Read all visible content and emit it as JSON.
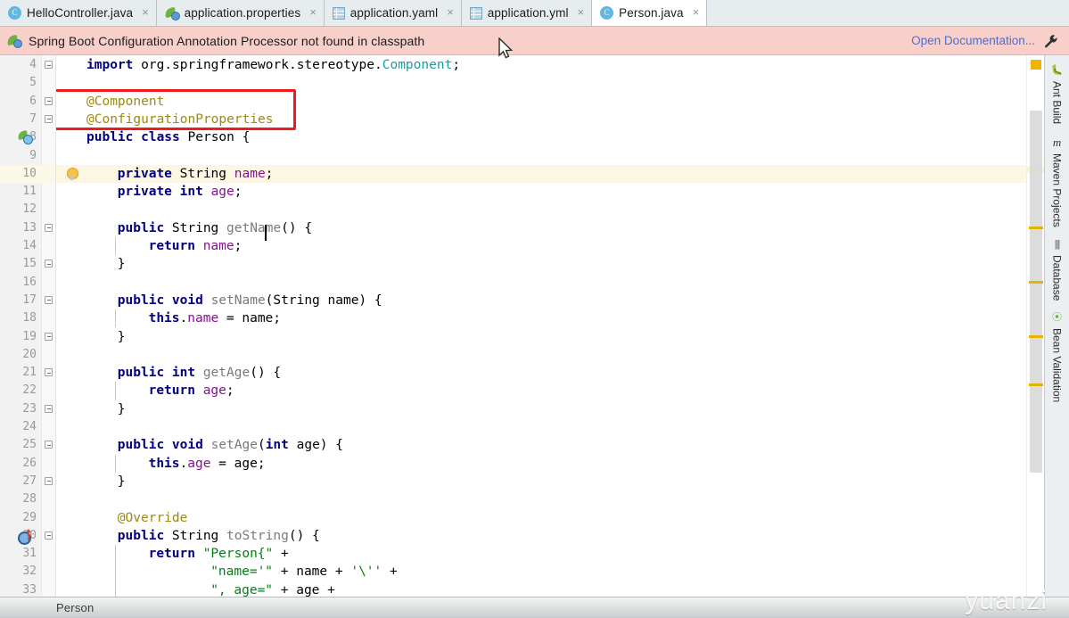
{
  "tabs": [
    {
      "label": "HelloController.java",
      "icon": "java-class-icon",
      "active": false,
      "close": "×"
    },
    {
      "label": "application.properties",
      "icon": "spring-properties-icon",
      "active": false,
      "close": "×"
    },
    {
      "label": "application.yaml",
      "icon": "yaml-file-icon",
      "active": false,
      "close": "×"
    },
    {
      "label": "application.yml",
      "icon": "yaml-file-icon",
      "active": false,
      "close": "×"
    },
    {
      "label": "Person.java",
      "icon": "java-class-icon",
      "active": true,
      "close": "×"
    }
  ],
  "banner": {
    "icon": "spring-boot-icon",
    "message": "Spring Boot Configuration Annotation Processor not found in classpath",
    "action_label": "Open Documentation...",
    "settings_icon": "wrench-icon",
    "background": "#f8cfc9",
    "link_color": "#4a6fd6"
  },
  "editor": {
    "caret_line": 10,
    "highlighted_line": 10,
    "lines": [
      {
        "n": "4",
        "indent": 0,
        "tokens": [
          {
            "t": "import ",
            "c": "kw"
          },
          {
            "t": "org.springframework.stereotype.",
            "c": "pln"
          },
          {
            "t": "Component",
            "c": "cls"
          },
          {
            "t": ";",
            "c": "pln"
          }
        ]
      },
      {
        "n": "5",
        "indent": 0,
        "tokens": []
      },
      {
        "n": "6",
        "indent": 0,
        "tokens": [
          {
            "t": "@Component",
            "c": "ann"
          }
        ]
      },
      {
        "n": "7",
        "indent": 0,
        "tokens": [
          {
            "t": "@ConfigurationProperties",
            "c": "ann"
          }
        ]
      },
      {
        "n": "8",
        "indent": 0,
        "tokens": [
          {
            "t": "public class ",
            "c": "kw"
          },
          {
            "t": "Person",
            "c": "pln"
          },
          {
            "t": " {",
            "c": "pln"
          }
        ]
      },
      {
        "n": "9",
        "indent": 0,
        "tokens": []
      },
      {
        "n": "10",
        "indent": 1,
        "tokens": [
          {
            "t": "private ",
            "c": "kw"
          },
          {
            "t": "String ",
            "c": "pln"
          },
          {
            "t": "name",
            "c": "fld"
          },
          {
            "t": ";",
            "c": "pln"
          }
        ]
      },
      {
        "n": "11",
        "indent": 1,
        "tokens": [
          {
            "t": "private int ",
            "c": "kw"
          },
          {
            "t": "age",
            "c": "fld"
          },
          {
            "t": ";",
            "c": "pln"
          }
        ]
      },
      {
        "n": "12",
        "indent": 0,
        "tokens": []
      },
      {
        "n": "13",
        "indent": 1,
        "tokens": [
          {
            "t": "public ",
            "c": "kw"
          },
          {
            "t": "String ",
            "c": "pln"
          },
          {
            "t": "getName",
            "c": "mth"
          },
          {
            "t": "() {",
            "c": "pln"
          }
        ]
      },
      {
        "n": "14",
        "indent": 2,
        "tokens": [
          {
            "t": "return ",
            "c": "kw"
          },
          {
            "t": "name",
            "c": "fld"
          },
          {
            "t": ";",
            "c": "pln"
          }
        ]
      },
      {
        "n": "15",
        "indent": 1,
        "tokens": [
          {
            "t": "}",
            "c": "pln"
          }
        ]
      },
      {
        "n": "16",
        "indent": 0,
        "tokens": []
      },
      {
        "n": "17",
        "indent": 1,
        "tokens": [
          {
            "t": "public void ",
            "c": "kw"
          },
          {
            "t": "setName",
            "c": "mth"
          },
          {
            "t": "(String name) {",
            "c": "pln"
          }
        ]
      },
      {
        "n": "18",
        "indent": 2,
        "tokens": [
          {
            "t": "this",
            "c": "kw"
          },
          {
            "t": ".",
            "c": "pln"
          },
          {
            "t": "name",
            "c": "fld"
          },
          {
            "t": " = name;",
            "c": "pln"
          }
        ]
      },
      {
        "n": "19",
        "indent": 1,
        "tokens": [
          {
            "t": "}",
            "c": "pln"
          }
        ]
      },
      {
        "n": "20",
        "indent": 0,
        "tokens": []
      },
      {
        "n": "21",
        "indent": 1,
        "tokens": [
          {
            "t": "public int ",
            "c": "kw"
          },
          {
            "t": "getAge",
            "c": "mth"
          },
          {
            "t": "() {",
            "c": "pln"
          }
        ]
      },
      {
        "n": "22",
        "indent": 2,
        "tokens": [
          {
            "t": "return ",
            "c": "kw"
          },
          {
            "t": "age",
            "c": "fld"
          },
          {
            "t": ";",
            "c": "pln"
          }
        ]
      },
      {
        "n": "23",
        "indent": 1,
        "tokens": [
          {
            "t": "}",
            "c": "pln"
          }
        ]
      },
      {
        "n": "24",
        "indent": 0,
        "tokens": []
      },
      {
        "n": "25",
        "indent": 1,
        "tokens": [
          {
            "t": "public void ",
            "c": "kw"
          },
          {
            "t": "setAge",
            "c": "mth"
          },
          {
            "t": "(",
            "c": "pln"
          },
          {
            "t": "int ",
            "c": "kw"
          },
          {
            "t": "age) {",
            "c": "pln"
          }
        ]
      },
      {
        "n": "26",
        "indent": 2,
        "tokens": [
          {
            "t": "this",
            "c": "kw"
          },
          {
            "t": ".",
            "c": "pln"
          },
          {
            "t": "age",
            "c": "fld"
          },
          {
            "t": " = age;",
            "c": "pln"
          }
        ]
      },
      {
        "n": "27",
        "indent": 1,
        "tokens": [
          {
            "t": "}",
            "c": "pln"
          }
        ]
      },
      {
        "n": "28",
        "indent": 0,
        "tokens": []
      },
      {
        "n": "29",
        "indent": 1,
        "tokens": [
          {
            "t": "@Override",
            "c": "ann"
          }
        ]
      },
      {
        "n": "30",
        "indent": 1,
        "tokens": [
          {
            "t": "public ",
            "c": "kw"
          },
          {
            "t": "String ",
            "c": "pln"
          },
          {
            "t": "toString",
            "c": "mth"
          },
          {
            "t": "() {",
            "c": "pln"
          }
        ]
      },
      {
        "n": "31",
        "indent": 2,
        "tokens": [
          {
            "t": "return ",
            "c": "kw"
          },
          {
            "t": "\"Person{\"",
            "c": "str"
          },
          {
            "t": " +",
            "c": "pln"
          }
        ]
      },
      {
        "n": "32",
        "indent": 4,
        "tokens": [
          {
            "t": "\"name='\"",
            "c": "str"
          },
          {
            "t": " + name + ",
            "c": "pln"
          },
          {
            "t": "'\\''",
            "c": "str"
          },
          {
            "t": " +",
            "c": "pln"
          }
        ]
      },
      {
        "n": "33",
        "indent": 4,
        "tokens": [
          {
            "t": "\", age=\"",
            "c": "str"
          },
          {
            "t": " + age +",
            "c": "pln"
          }
        ]
      }
    ],
    "annotation_box": {
      "color": "#ee1c1c",
      "covers_lines": [
        6,
        7
      ],
      "label": "highlight-annotations"
    },
    "gutter_icons": [
      {
        "line": 8,
        "name": "spring-bean-gutter-icon"
      },
      {
        "line": 30,
        "name": "override-method-gutter-icon"
      },
      {
        "line": 10,
        "name": "intention-bulb-icon"
      }
    ]
  },
  "scrollbar": {
    "name": "editor-error-stripe",
    "top_marker_color": "#f0b400",
    "marker_color": "#e8b300",
    "thumb_color": "#d6d6d6",
    "markers": [
      1,
      2,
      3,
      4
    ]
  },
  "right_toolbar": {
    "items": [
      {
        "label": "Ant Build",
        "icon": "ant-icon"
      },
      {
        "label": "Maven Projects",
        "icon": "maven-icon"
      },
      {
        "label": "Database",
        "icon": "database-icon"
      },
      {
        "label": "Bean Validation",
        "icon": "bean-validation-icon"
      }
    ]
  },
  "status_bar": {
    "breadcrumb": "Person"
  },
  "watermark": "yuanzi"
}
